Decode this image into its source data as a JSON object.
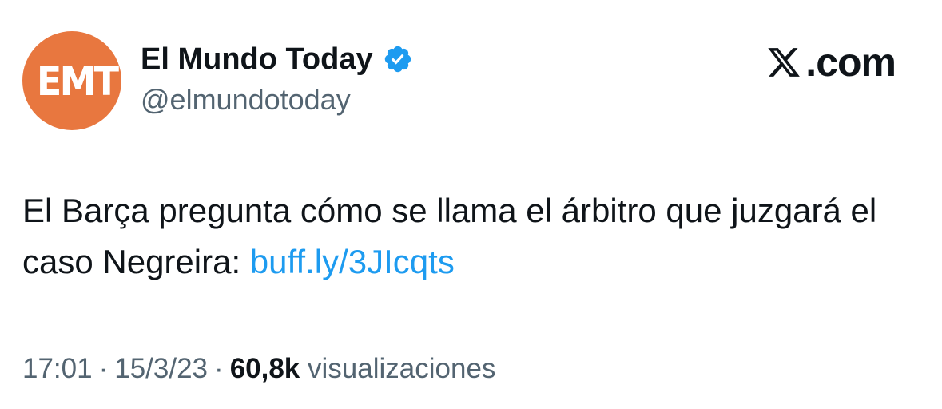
{
  "author": {
    "avatar_text": "EMT",
    "name": "El Mundo Today",
    "handle": "@elmundotoday",
    "verified_icon": "verified-badge-icon"
  },
  "brand": {
    "logo_icon": "x-logo-icon",
    "text": ".com"
  },
  "tweet": {
    "text": "El Barça pregunta cómo se llama el árbitro que juzgará el caso Negreira:",
    "link_text": "buff.ly/3JIcqts"
  },
  "meta": {
    "time": "17:01",
    "separator": "·",
    "date": "15/3/23",
    "views_count": "60,8k",
    "views_label": "visualizaciones"
  },
  "colors": {
    "avatar_bg": "#e8773f",
    "link": "#1d9bf0",
    "verified": "#1d9bf0",
    "secondary_text": "#536471",
    "primary_text": "#0f1419"
  }
}
